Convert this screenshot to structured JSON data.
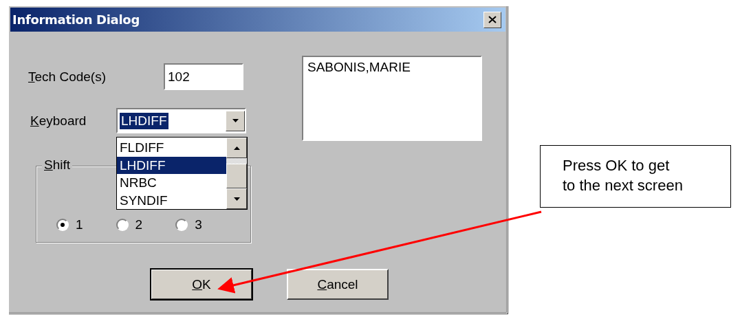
{
  "window": {
    "title": "Information Dialog"
  },
  "tech_code": {
    "label": "Tech Code(s)",
    "mnemonic": true,
    "value": "102"
  },
  "name_list": {
    "items": [
      "SABONIS,MARIE"
    ]
  },
  "keyboard": {
    "label": "Keyboard",
    "mnemonic": true,
    "value": "LHDIFF",
    "value_highlighted": true,
    "expanded": true,
    "options": [
      {
        "label": "FLDIFF",
        "selected": false
      },
      {
        "label": "LHDIFF",
        "selected": true
      },
      {
        "label": "NRBC",
        "selected": false
      },
      {
        "label": "SYNDIF",
        "selected": false
      }
    ]
  },
  "shift": {
    "label": "Shift",
    "mnemonic": true,
    "options": [
      {
        "label": "1",
        "selected": true
      },
      {
        "label": "2",
        "selected": false
      },
      {
        "label": "3",
        "selected": false
      }
    ]
  },
  "buttons": [
    {
      "label": "OK",
      "mnemonic": true,
      "default": true
    },
    {
      "label": "Cancel",
      "mnemonic": true,
      "default": false
    }
  ],
  "callout": {
    "lines": [
      "Press OK to get",
      "to the next screen"
    ]
  }
}
